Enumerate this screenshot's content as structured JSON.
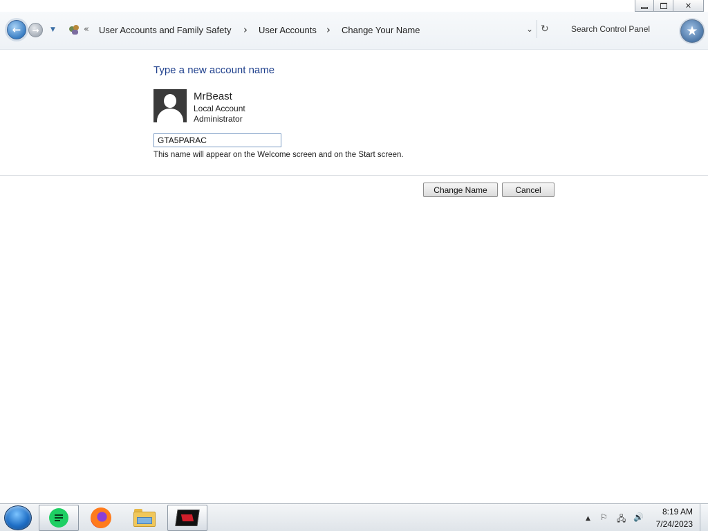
{
  "window": {
    "caption": {
      "minimize_icon": "minimize-icon",
      "restore_icon": "restore-icon",
      "close_icon": "close-icon"
    }
  },
  "navbar": {
    "back_icon": "back-arrow-icon",
    "forward_icon": "forward-arrow-icon",
    "history_icon": "dropdown-arrow-icon",
    "location_icon": "control-panel-icon",
    "overflow_chevron": "«",
    "breadcrumbs": [
      "User Accounts and Family Safety",
      "User Accounts",
      "Change Your Name"
    ],
    "separator": "›",
    "address_dropdown": "⌄",
    "refresh_icon": "↻",
    "search_placeholder": "Search Control Panel",
    "search_button_icon": "★"
  },
  "content": {
    "heading": "Type a new account name",
    "account": {
      "name": "MrBeast",
      "type": "Local Account",
      "role": "Administrator",
      "avatar_icon": "user-silhouette-icon"
    },
    "name_input_value": "GTA5PARAC",
    "hint": "This name will appear on the Welcome screen and on the Start screen.",
    "buttons": {
      "change": "Change Name",
      "cancel": "Cancel"
    }
  },
  "taskbar": {
    "pinned_apps": [
      {
        "name": "notes-app",
        "active": true
      },
      {
        "name": "firefox",
        "active": false
      },
      {
        "name": "file-explorer",
        "active": false
      },
      {
        "name": "game-app",
        "active": true
      }
    ],
    "tray": {
      "show_hidden_icon": "▲",
      "flag_icon": "⚐",
      "network_icon": "🖧",
      "volume_icon": "🔊"
    },
    "clock": {
      "time": "8:19 AM",
      "date": "7/24/2023"
    }
  }
}
